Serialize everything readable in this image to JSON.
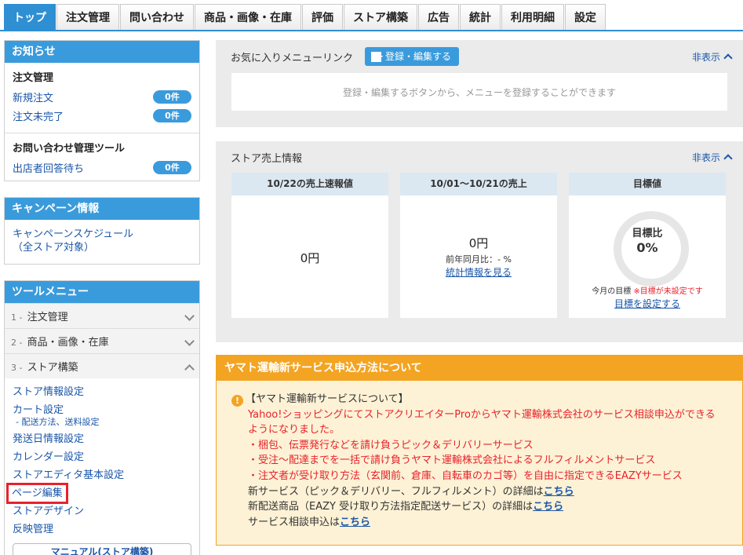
{
  "tabs": [
    "トップ",
    "注文管理",
    "問い合わせ",
    "商品・画像・在庫",
    "評価",
    "ストア構築",
    "広告",
    "統計",
    "利用明細",
    "設定"
  ],
  "notice": {
    "title": "お知らせ",
    "group1_title": "注文管理",
    "new_order": "新規注文",
    "new_order_count": "0件",
    "order_incomplete": "注文未完了",
    "order_incomplete_count": "0件",
    "group2_title": "お問い合わせ管理ツール",
    "awaiting_reply": "出店者回答待ち",
    "awaiting_reply_count": "0件"
  },
  "campaign": {
    "title": "キャンペーン情報",
    "link_line1": "キャンペーンスケジュール",
    "link_line2": "（全ストア対象）"
  },
  "tools": {
    "title": "ツールメニュー",
    "acc1_num": "1 -",
    "acc1": "注文管理",
    "acc2_num": "2 -",
    "acc2": "商品・画像・在庫",
    "acc3_num": "3 -",
    "acc3": "ストア構築",
    "items": {
      "store_info": "ストア情報設定",
      "cart": "カート設定",
      "shipping": "- 配送方法、送料設定",
      "ship_date": "発送日情報設定",
      "calendar": "カレンダー設定",
      "editor_basic": "ストアエディタ基本設定",
      "page_edit": "ページ編集",
      "store_design": "ストアデザイン",
      "publish": "反映管理"
    },
    "manual": "マニュアル(ストア構築)"
  },
  "favorites": {
    "title": "お気に入りメニューリンク",
    "button": "登録・編集する",
    "hide": "非表示",
    "empty_msg": "登録・編集するボタンから、メニューを登録することができます"
  },
  "sales": {
    "title": "ストア売上情報",
    "hide": "非表示",
    "card1_head": "10/22の売上速報値",
    "card1_value": "0円",
    "card2_head": "10/01～10/21の売上",
    "card2_value": "0円",
    "card2_sub": "前年同月比：- %",
    "card2_link": "統計情報を見る",
    "card3_head": "目標値",
    "ratio_label": "目標比",
    "ratio_value": "0%",
    "goal_label": "今月の目標",
    "goal_unset": "※目標が未設定です",
    "goal_link": "目標を設定する"
  },
  "yamato": {
    "title": "ヤマト運輸新サービス申込方法について",
    "heading": "【ヤマト運輸新サービスについて】",
    "red1": "Yahoo!ショッピングにてストアクリエイターProからヤマト運輸株式会社のサービス相談申込ができる",
    "red2": "ようになりました。",
    "red3": "・梱包、伝票発行などを請け負うピック＆デリバリーサービス",
    "red4": "・受注～配達までを一括で請け負うヤマト運輸株式会社によるフルフィルメントサービス",
    "red5": "・注文者が受け取り方法（玄関前、倉庫、自転車のカゴ等）を自由に指定できるEAZYサービス",
    "line6": "新サービス（ピック＆デリバリー、フルフィルメント）の詳細は",
    "line7": "新配送商品（EAZY 受け取り方法指定配送サービス）の詳細は",
    "line8": "サービス相談申込は",
    "link": "こちら"
  }
}
